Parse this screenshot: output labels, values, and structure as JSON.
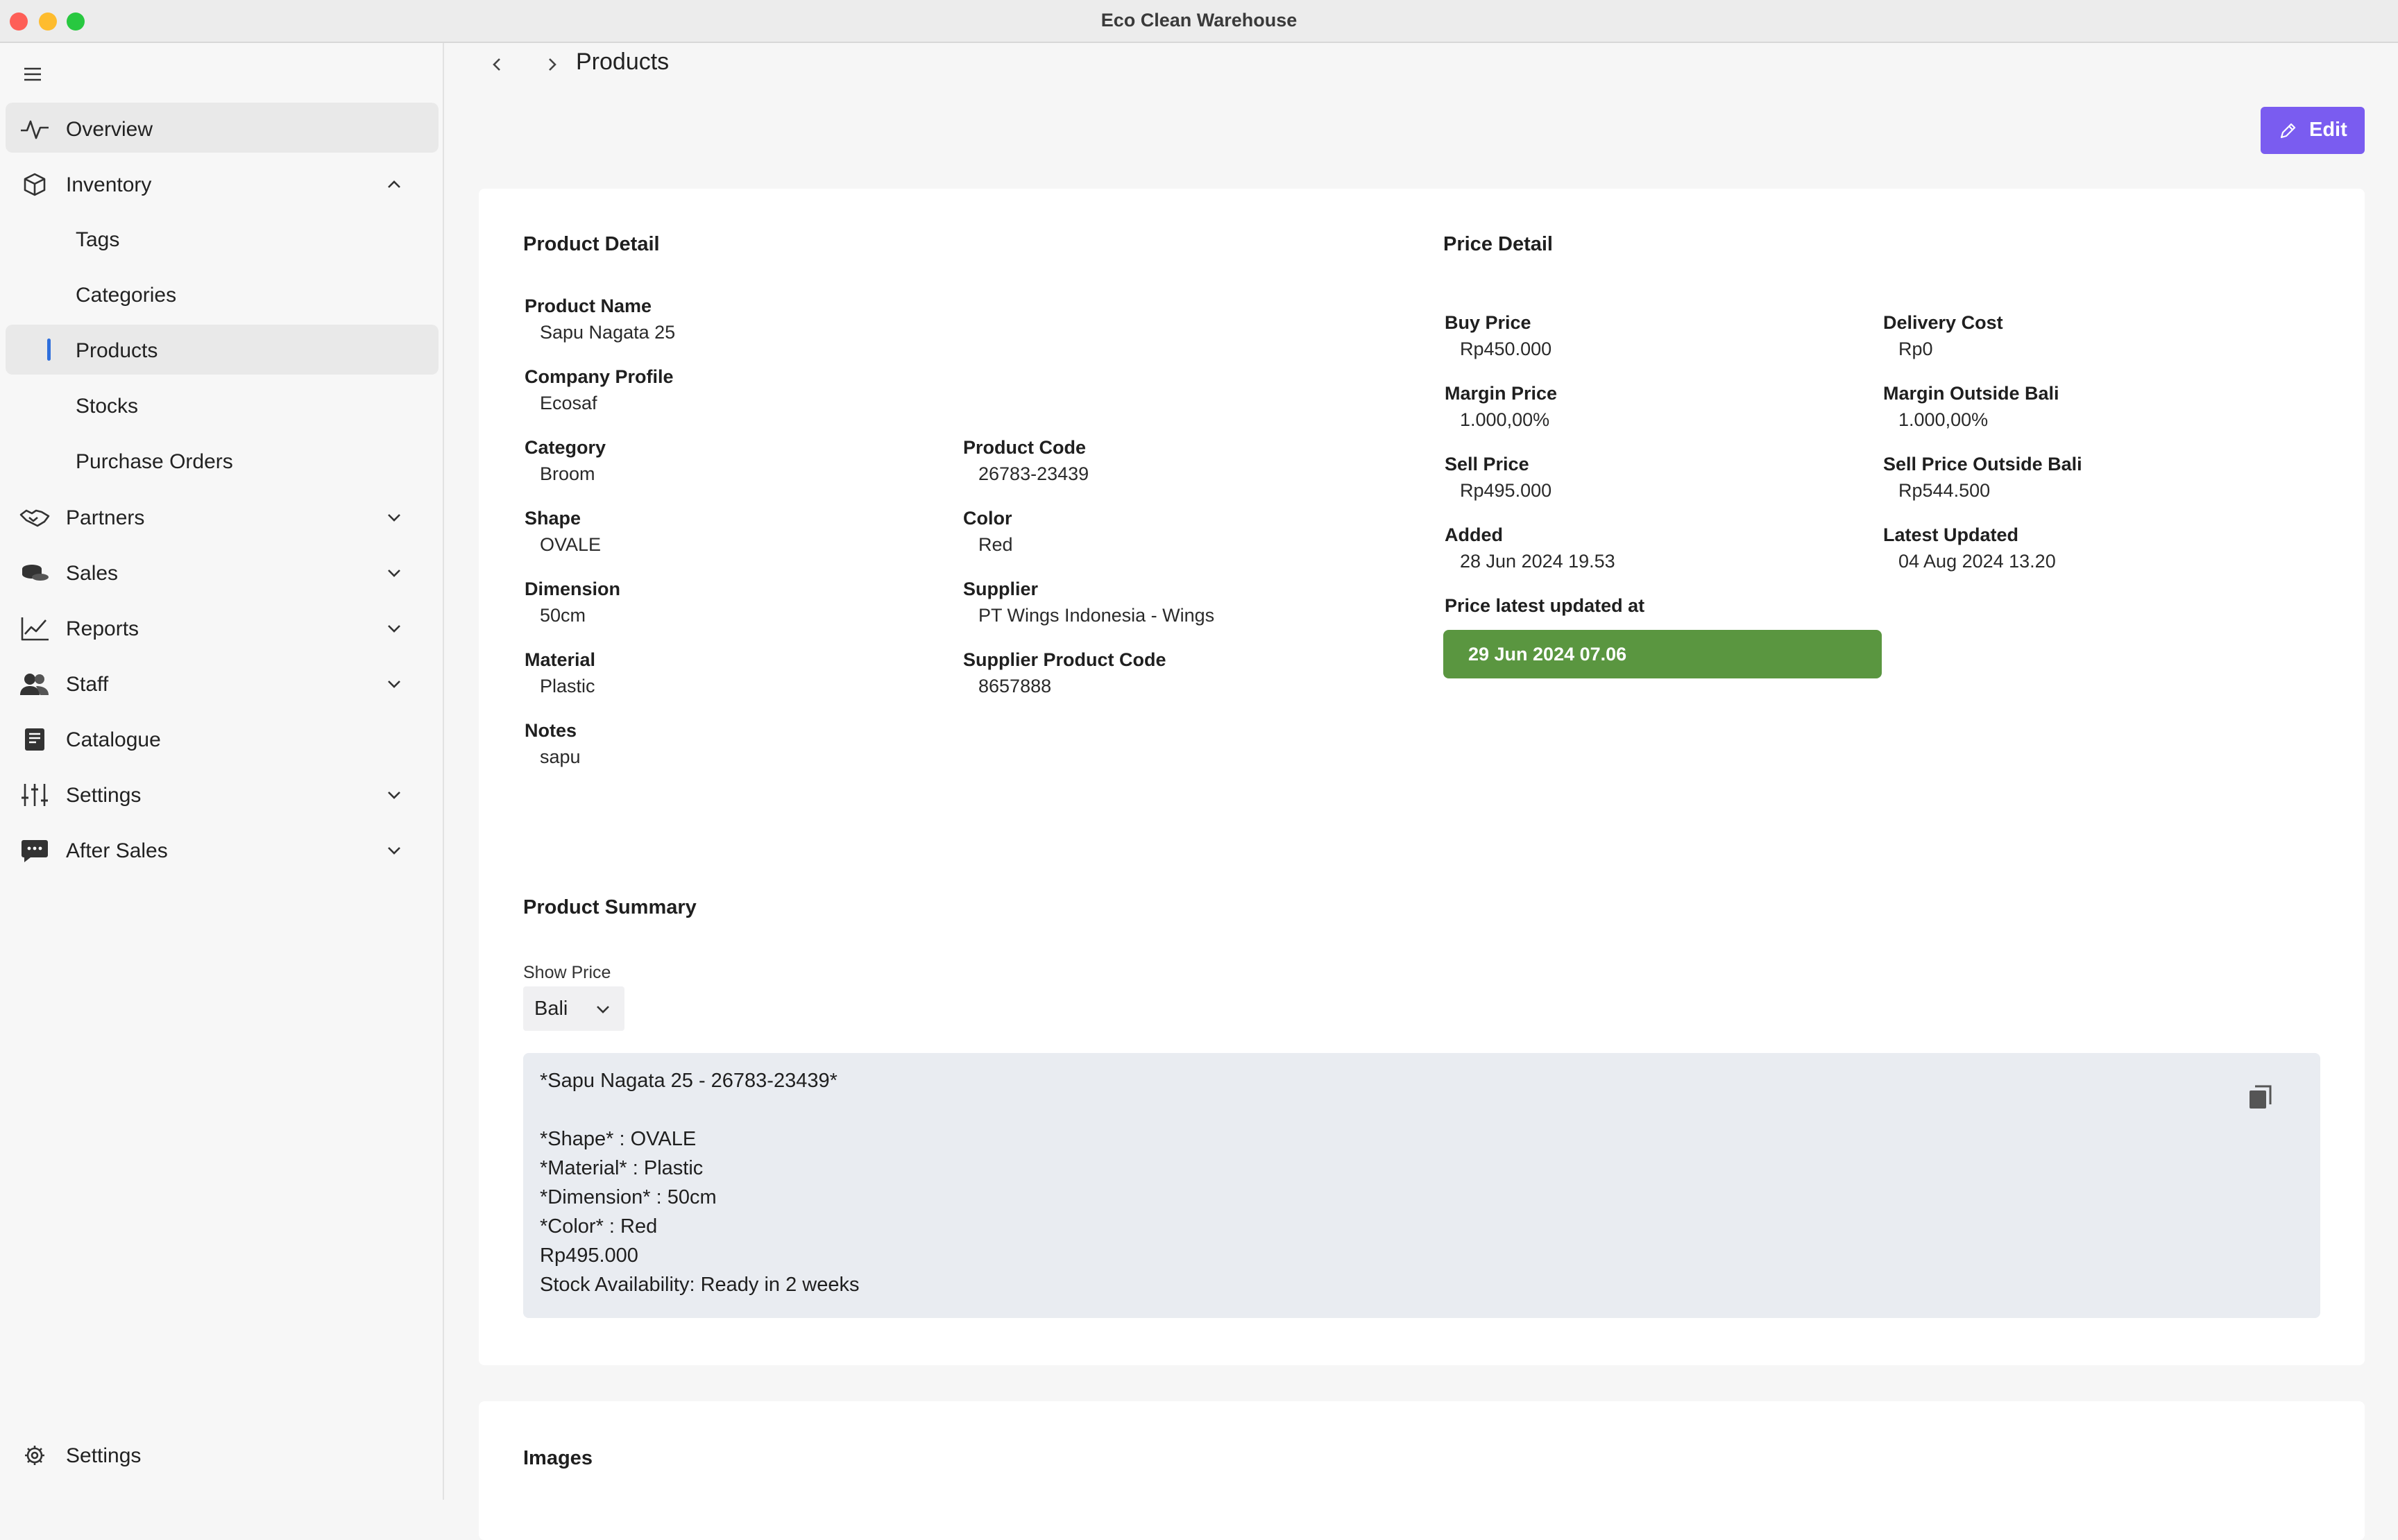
{
  "window": {
    "title": "Eco Clean Warehouse"
  },
  "sidebar": {
    "items": [
      {
        "label": "Overview",
        "icon": "activity-icon"
      },
      {
        "label": "Inventory",
        "icon": "box-icon",
        "expanded": true
      },
      {
        "label": "Partners",
        "icon": "handshake-icon"
      },
      {
        "label": "Sales",
        "icon": "coins-icon"
      },
      {
        "label": "Reports",
        "icon": "chart-line-icon"
      },
      {
        "label": "Staff",
        "icon": "users-icon"
      },
      {
        "label": "Catalogue",
        "icon": "book-icon"
      },
      {
        "label": "Settings",
        "icon": "sliders-icon"
      },
      {
        "label": "After Sales",
        "icon": "chat-icon"
      }
    ],
    "inventory_sub": [
      "Tags",
      "Categories",
      "Products",
      "Stocks",
      "Purchase Orders"
    ],
    "bottom_settings": "Settings"
  },
  "header": {
    "title": "Products",
    "edit_label": "Edit"
  },
  "product_detail": {
    "title": "Product Detail",
    "product_name_label": "Product Name",
    "product_name": "Sapu Nagata 25",
    "company_profile_label": "Company Profile",
    "company_profile": "Ecosaf",
    "category_label": "Category",
    "category": "Broom",
    "product_code_label": "Product Code",
    "product_code": "26783-23439",
    "shape_label": "Shape",
    "shape": "OVALE",
    "color_label": "Color",
    "color": "Red",
    "dimension_label": "Dimension",
    "dimension": "50cm",
    "supplier_label": "Supplier",
    "supplier": "PT Wings Indonesia - Wings",
    "material_label": "Material",
    "material": "Plastic",
    "supplier_code_label": "Supplier Product Code",
    "supplier_code": "8657888",
    "notes_label": "Notes",
    "notes": "sapu"
  },
  "price_detail": {
    "title": "Price Detail",
    "buy_price_label": "Buy Price",
    "buy_price": "Rp450.000",
    "delivery_cost_label": "Delivery Cost",
    "delivery_cost": "Rp0",
    "margin_price_label": "Margin Price",
    "margin_price": "1.000,00%",
    "margin_outside_label": "Margin Outside Bali",
    "margin_outside": "1.000,00%",
    "sell_price_label": "Sell Price",
    "sell_price": "Rp495.000",
    "sell_outside_label": "Sell Price Outside Bali",
    "sell_outside": "Rp544.500",
    "added_label": "Added",
    "added": "28 Jun 2024 19.53",
    "latest_updated_label": "Latest Updated",
    "latest_updated": "04 Aug 2024 13.20",
    "price_updated_label": "Price latest updated at",
    "price_updated": "29 Jun 2024 07.06",
    "badge_color": "#5a9640"
  },
  "summary": {
    "title": "Product Summary",
    "show_price_label": "Show Price",
    "show_price_value": "Bali",
    "lines": [
      "*Sapu Nagata 25 - 26783-23439*",
      "",
      "*Shape* : OVALE",
      "*Material* : Plastic",
      "*Dimension* : 50cm",
      "*Color* : Red",
      "Rp495.000",
      "Stock Availability: Ready in 2 weeks"
    ]
  },
  "images": {
    "title": "Images"
  },
  "colors": {
    "accent": "#7a5cf0",
    "active_marker": "#2f6fdc"
  }
}
